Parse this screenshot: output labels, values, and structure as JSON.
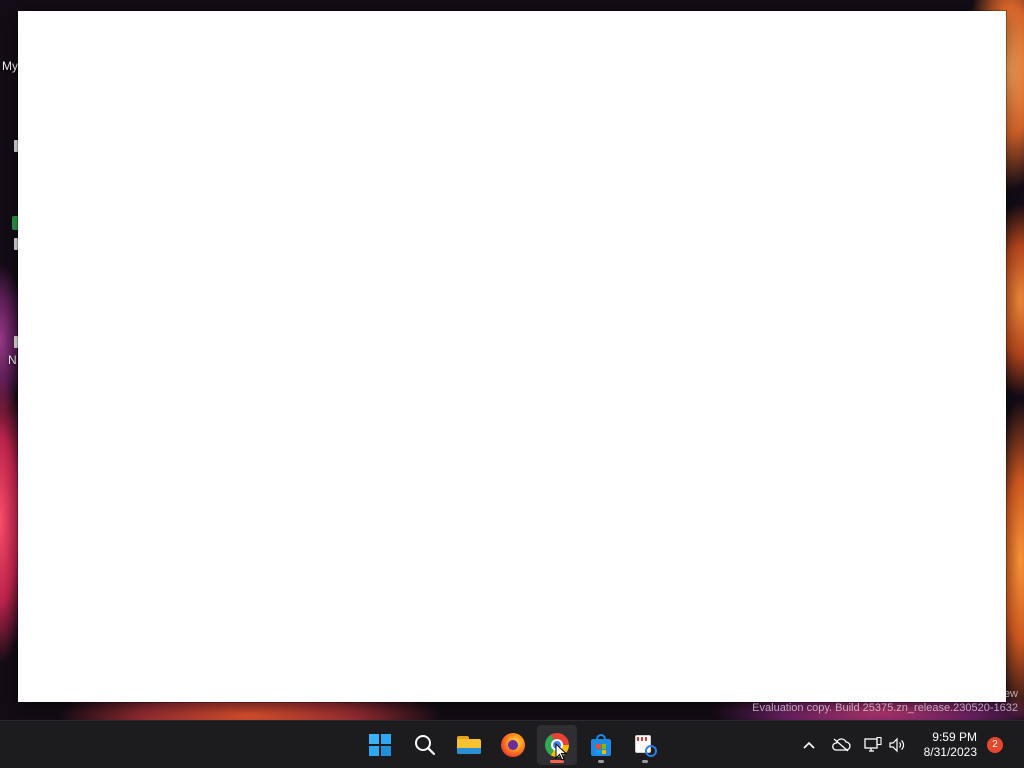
{
  "desktop": {
    "labels": {
      "my": "My",
      "n": "N"
    }
  },
  "watermark": {
    "line1": "ew",
    "line2": "Evaluation copy. Build 25375.zn_release.230520-1632"
  },
  "taskbar": {
    "apps": [
      {
        "name": "Start",
        "icon": "windows-logo-icon",
        "state": "idle"
      },
      {
        "name": "Search",
        "icon": "search-icon",
        "state": "idle"
      },
      {
        "name": "File Explorer",
        "icon": "folder-icon",
        "state": "idle"
      },
      {
        "name": "Firefox",
        "icon": "firefox-icon",
        "state": "idle"
      },
      {
        "name": "Google Chrome",
        "icon": "chrome-icon",
        "state": "focused"
      },
      {
        "name": "Microsoft Store",
        "icon": "store-icon",
        "state": "running"
      },
      {
        "name": "Snipping Tool",
        "icon": "snipping-tool-icon",
        "state": "running"
      }
    ],
    "tray": {
      "time": "9:59 PM",
      "date": "8/31/2023",
      "notification_count": "2"
    }
  },
  "colors": {
    "taskbar_bg": "#1c1c1e",
    "window_bg": "#ffffff",
    "focus_indicator": "#ff5f4f"
  }
}
